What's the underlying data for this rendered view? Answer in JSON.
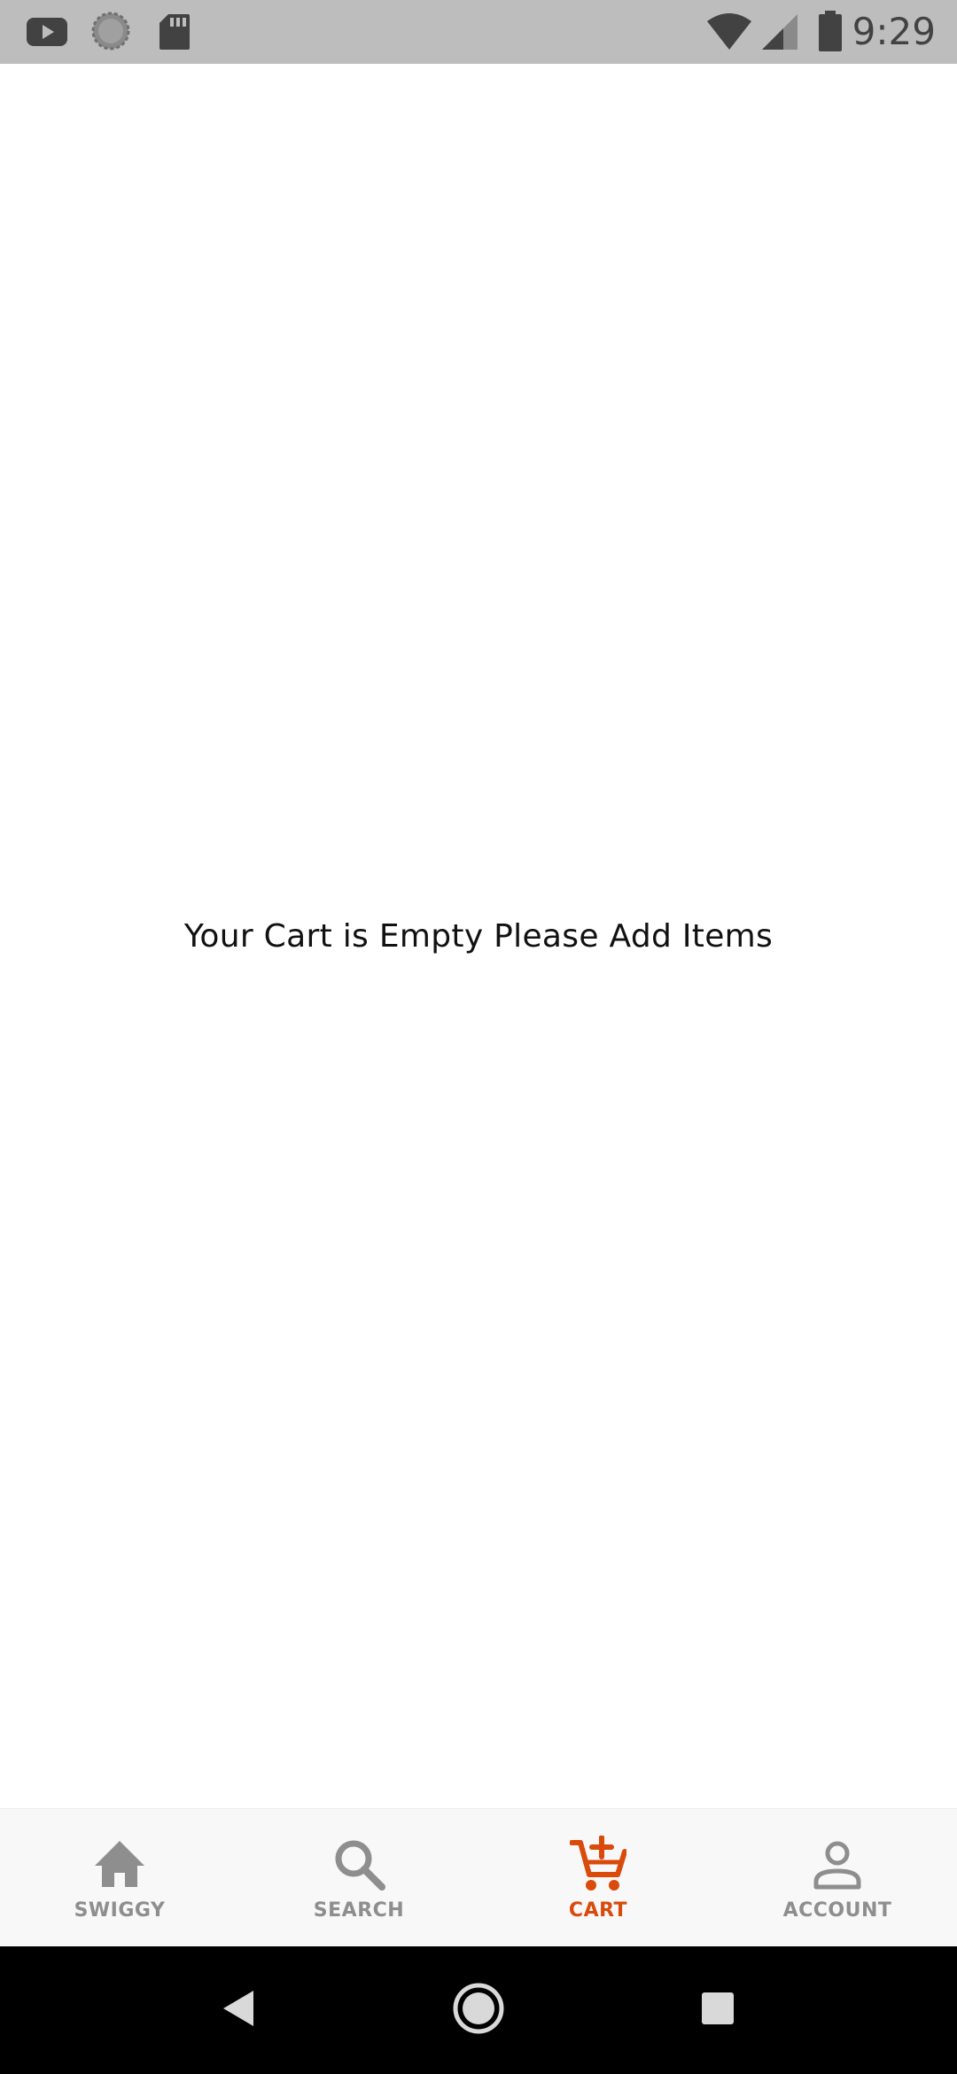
{
  "status_bar": {
    "time": "9:29",
    "icons": [
      "youtube-icon",
      "loading-icon",
      "sd-card-icon",
      "wifi-icon",
      "cell-signal-icon",
      "battery-icon"
    ]
  },
  "cart": {
    "empty_message": "Your Cart is Empty Please Add Items"
  },
  "bottom_nav": {
    "items": [
      {
        "label": "SWIGGY",
        "icon": "home-icon",
        "active": false
      },
      {
        "label": "SEARCH",
        "icon": "search-icon",
        "active": false
      },
      {
        "label": "CART",
        "icon": "cart-add-icon",
        "active": true
      },
      {
        "label": "ACCOUNT",
        "icon": "account-icon",
        "active": false
      }
    ]
  },
  "system_nav": {
    "icons": [
      "back-icon",
      "home-circle-icon",
      "recents-icon"
    ]
  },
  "colors": {
    "accent": "#d94a0b",
    "inactive": "#8e8e8e",
    "status_bar": "#bdbdbd",
    "nav_background": "#f8f8f8"
  }
}
